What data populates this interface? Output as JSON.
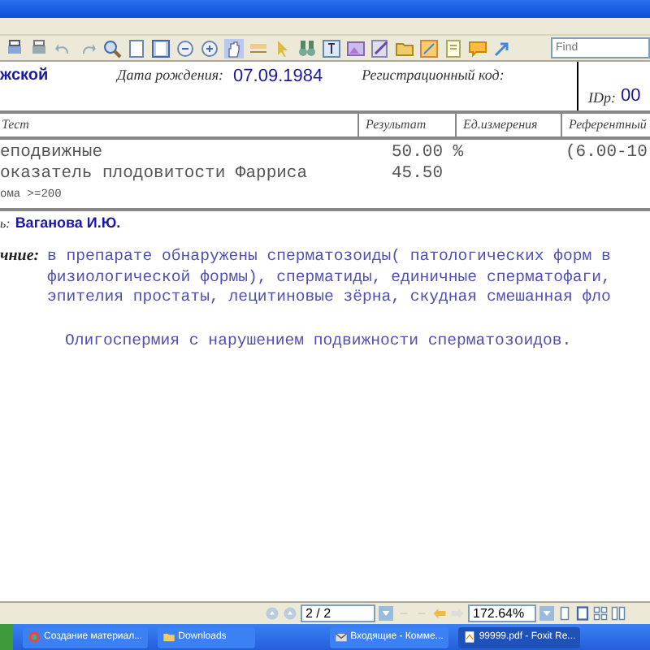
{
  "toolbar": {
    "search": {
      "placeholder": "Find"
    }
  },
  "header": {
    "patient_fragment": "жской",
    "birth_label": "Дата рождения:",
    "birth_date": "07.09.1984",
    "reg_label": "Регистрационный код:",
    "id_label": "IDр:",
    "id_value": "00"
  },
  "table": {
    "columns": [
      "Тест",
      "Результат",
      "Ед.измерения",
      "Референтный"
    ],
    "rows": [
      {
        "test": "еподвижные",
        "result": "50.00 %",
        "reference": "(6.00-10"
      },
      {
        "test": "оказатель плодовитости Фарриса",
        "result": "45.50",
        "reference": ""
      }
    ],
    "note": "ома >=200"
  },
  "doctor": {
    "label": "ь:",
    "name": "Ваганова И.Ю."
  },
  "conclusion": {
    "label": "чние:",
    "lines": [
      "в препарате обнаружены сперматозоиды( патологических форм в",
      "физиологической формы), сперматиды, единичные сперматофаги,",
      "эпителия простаты, лецитиновые зёрна, скудная смешанная фло"
    ],
    "summary": "Олигоспермия с нарушением подвижности сперматозоидов."
  },
  "status_bar": {
    "page": "2 / 2",
    "zoom": "172.64%"
  },
  "taskbar": {
    "tasks": [
      {
        "label": "Создание материал...",
        "selected": false
      },
      {
        "label": "Downloads",
        "selected": false
      },
      {
        "label": "Входящие - Комме...",
        "selected": false
      },
      {
        "label": "99999.pdf - Foxit Re...",
        "selected": true
      }
    ]
  }
}
